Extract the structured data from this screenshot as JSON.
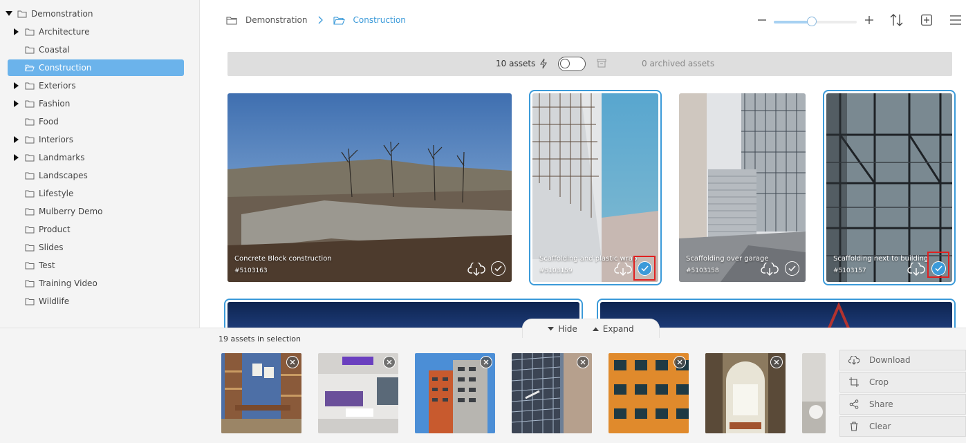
{
  "sidebar": {
    "tree": [
      {
        "label": "Demonstration",
        "expandable": true,
        "expanded": true,
        "level": 0
      },
      {
        "label": "Architecture",
        "expandable": true,
        "level": 1
      },
      {
        "label": "Coastal",
        "expandable": false,
        "level": 1
      },
      {
        "label": "Construction",
        "expandable": false,
        "level": 1,
        "selected": true
      },
      {
        "label": "Exteriors",
        "expandable": true,
        "level": 1
      },
      {
        "label": "Fashion",
        "expandable": true,
        "level": 1
      },
      {
        "label": "Food",
        "expandable": false,
        "level": 1
      },
      {
        "label": "Interiors",
        "expandable": true,
        "level": 1
      },
      {
        "label": "Landmarks",
        "expandable": true,
        "level": 1
      },
      {
        "label": "Landscapes",
        "expandable": false,
        "level": 1
      },
      {
        "label": "Lifestyle",
        "expandable": false,
        "level": 1
      },
      {
        "label": "Mulberry Demo",
        "expandable": false,
        "level": 1
      },
      {
        "label": "Product",
        "expandable": false,
        "level": 1
      },
      {
        "label": "Slides",
        "expandable": false,
        "level": 1
      },
      {
        "label": "Test",
        "expandable": false,
        "level": 1
      },
      {
        "label": "Training Video",
        "expandable": false,
        "level": 1
      },
      {
        "label": "Wildlife",
        "expandable": false,
        "level": 1
      }
    ]
  },
  "breadcrumb": {
    "root": "Demonstration",
    "current": "Construction"
  },
  "toolbar": {
    "zoom_level": 0.47,
    "icons": [
      "zoom-out-icon",
      "zoom-in-icon",
      "sort-icon",
      "add-icon",
      "menu-icon"
    ]
  },
  "status": {
    "asset_count": "10 assets",
    "archived": "0 archived assets",
    "show_archived": false
  },
  "assets": [
    {
      "title": "Concrete Block construction",
      "id": "#5103163",
      "selected": false
    },
    {
      "title": "Scaffolding and plastic wrap",
      "id": "#5103159",
      "selected": true
    },
    {
      "title": "Scaffolding over garage",
      "id": "#5103158",
      "selected": false
    },
    {
      "title": "Scaffolding next to building",
      "id": "#5103157",
      "selected": true
    }
  ],
  "panel": {
    "hide_label": "Hide",
    "expand_label": "Expand",
    "selection_count": "19 assets in selection",
    "actions": [
      {
        "label": "Download",
        "icon": "download-icon"
      },
      {
        "label": "Crop",
        "icon": "crop-icon"
      },
      {
        "label": "Share",
        "icon": "share-icon"
      },
      {
        "label": "Clear",
        "icon": "trash-icon"
      }
    ]
  },
  "colors": {
    "accent": "#3b9ad9",
    "selected_folder": "#6bb3eb",
    "highlight": "#e02020"
  }
}
